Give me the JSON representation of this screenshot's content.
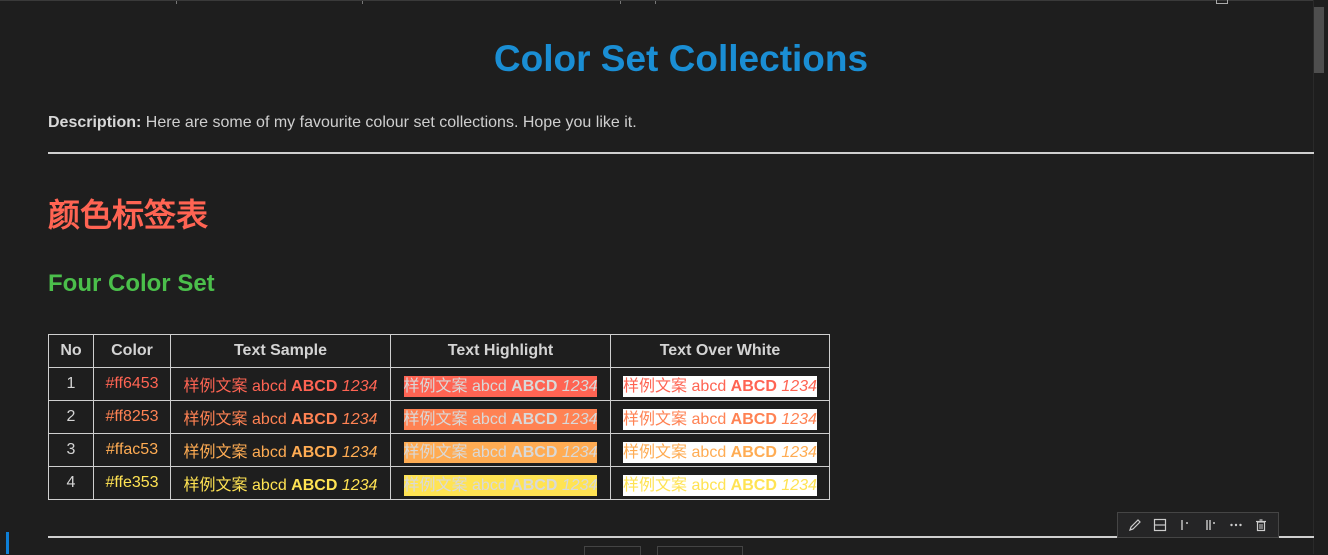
{
  "document": {
    "title": "Color Set Collections",
    "description_label": "Description:",
    "description_text": " Here are some of my favourite colour set collections. Hope you like it.",
    "heading_cn": "颜色标签表",
    "heading_set": "Four Color Set"
  },
  "table": {
    "headers": [
      "No",
      "Color",
      "Text Sample",
      "Text Highlight",
      "Text Over White"
    ],
    "sample_parts": {
      "cn": "样例文案",
      "lower": "abcd",
      "upper": "ABCD",
      "digits": "1234"
    },
    "rows": [
      {
        "no": "1",
        "color": "#ff6453"
      },
      {
        "no": "2",
        "color": "#ff8253"
      },
      {
        "no": "3",
        "color": "#ffac53"
      },
      {
        "no": "4",
        "color": "#ffe353"
      }
    ]
  },
  "toolbar": {
    "icons": [
      "pencil-icon",
      "split-cell-icon",
      "run-above-icon",
      "run-below-icon",
      "more-icon",
      "delete-icon"
    ]
  },
  "colors": {
    "title": "#1a8ed4",
    "heading_cn": "#ff6453",
    "heading_set": "#4bbf4b",
    "background": "#1e1e1e"
  }
}
